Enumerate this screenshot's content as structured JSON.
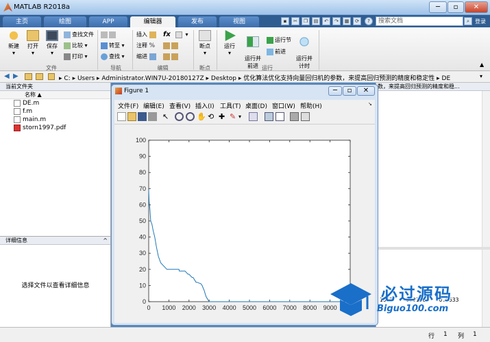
{
  "window": {
    "title": "MATLAB R2018a"
  },
  "tabs": [
    {
      "label": "主页"
    },
    {
      "label": "绘图"
    },
    {
      "label": "APP"
    },
    {
      "label": "编辑器"
    },
    {
      "label": "发布"
    },
    {
      "label": "视图"
    }
  ],
  "search": {
    "placeholder": "搜索文档"
  },
  "login": "登录",
  "ribbon": {
    "new": "新建",
    "open": "打开",
    "save": "保存",
    "find_file": "查找文件",
    "compare": "比较",
    "print": "打印",
    "file_group": "文件",
    "goto": "转至",
    "find": "查找",
    "nav_group": "导航",
    "insert": "插入",
    "comment": "注释",
    "indent": "缩进",
    "fx": "fx",
    "edit_group": "编辑",
    "breakpoint": "断点",
    "breakpoint_group": "断点",
    "run": "运行",
    "run_advance": "运行并\n前进",
    "run_section": "运行节",
    "advance": "前进",
    "run_time": "运行并\n计时",
    "run_group": "运行"
  },
  "address": {
    "segments": [
      "C:",
      "Users",
      "Administrator.WIN7U-20180127Z",
      "Desktop",
      "优化算法优化支持向量回归机的参数，来提高回归预测的精度和稳定性",
      "DE"
    ]
  },
  "current_folder": {
    "title": "当前文件夹",
    "column": "名称 ▲",
    "files": [
      {
        "name": "DE.m"
      },
      {
        "name": "f.m"
      },
      {
        "name": "main.m"
      },
      {
        "name": "storn1997.pdf"
      }
    ]
  },
  "details": {
    "title": "详细信息",
    "hint": "选择文件以查看详细信息"
  },
  "right_header": "数，来提高回归预测的精度和稳...",
  "console_values": ".1662   -0.0156    0.0533",
  "statusbar": {
    "row_label": "行",
    "row": "1",
    "col_label": "列",
    "col": "1"
  },
  "figure": {
    "title": "Figure 1",
    "menu": [
      "文件(F)",
      "编辑(E)",
      "查看(V)",
      "插入(I)",
      "工具(T)",
      "桌面(D)",
      "窗口(W)",
      "帮助(H)"
    ]
  },
  "watermark": {
    "main": "必过源码",
    "sub": "Biguo100.com"
  },
  "chart_data": {
    "type": "line",
    "xlim": [
      0,
      10000
    ],
    "ylim": [
      0,
      100
    ],
    "xticks": [
      0,
      1000,
      2000,
      3000,
      4000,
      5000,
      6000,
      7000,
      8000,
      9000,
      10000
    ],
    "yticks": [
      0,
      10,
      20,
      30,
      40,
      50,
      60,
      70,
      80,
      90,
      100
    ],
    "grid": false,
    "x": [
      0,
      20,
      60,
      100,
      160,
      220,
      300,
      380,
      480,
      600,
      900,
      1500,
      1520,
      1800,
      1950,
      2000,
      2150,
      2200,
      2350,
      2400,
      2600,
      2650,
      2750,
      2800,
      2850,
      2900,
      2950,
      3000,
      10000
    ],
    "y": [
      69,
      62,
      57,
      50,
      48,
      44,
      40,
      34,
      28,
      24,
      20,
      20,
      19,
      19,
      17,
      17,
      15,
      15,
      12,
      12,
      11,
      10,
      7,
      5,
      3,
      2,
      1,
      0,
      0
    ],
    "color": "#1f77b4"
  }
}
